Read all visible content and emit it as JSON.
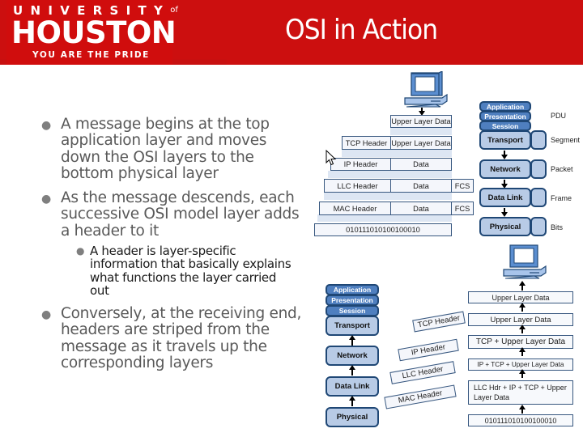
{
  "header": {
    "logo": {
      "line1": "UNIVERSITY",
      "line1_suffix": "of",
      "line2": "HOUSTON",
      "line3": "YOU ARE THE PRIDE"
    },
    "title": "OSI in Action",
    "brand_color": "#cc0f0f"
  },
  "bullets": [
    {
      "level": 1,
      "text": [
        "A message begins at the top",
        "application layer and moves",
        "down the OSI layers to the",
        "bottom physical layer"
      ]
    },
    {
      "level": 1,
      "text": [
        "As the message descends, each",
        "successive OSI model layer adds",
        "a header to it"
      ]
    },
    {
      "level": 2,
      "text": [
        "A header is layer-specific",
        "information that basically explains",
        "what functions the layer carried",
        "out"
      ]
    },
    {
      "level": 1,
      "text": [
        "Conversely, at the receiving end,",
        "headers are striped from the",
        "message as it travels up the",
        "corresponding layers"
      ]
    }
  ],
  "sending_diagram": {
    "encapsulation_rows": [
      {
        "cells": [
          "Upper Layer Data"
        ]
      },
      {
        "cells": [
          "TCP Header",
          "Upper Layer Data"
        ]
      },
      {
        "cells": [
          "IP Header",
          "Data"
        ]
      },
      {
        "cells": [
          "LLC Header",
          "Data",
          "FCS"
        ]
      },
      {
        "cells": [
          "MAC Header",
          "Data",
          "FCS"
        ]
      },
      {
        "cells": [
          "010111010100100010"
        ]
      }
    ],
    "layers": {
      "upper": [
        "Application",
        "Presentation",
        "Session"
      ],
      "main": [
        "Transport",
        "Network",
        "Data Link",
        "Physical"
      ]
    },
    "pdu_header": "PDU",
    "pdu_labels": [
      "Segment",
      "Packet",
      "Frame",
      "Bits"
    ]
  },
  "receiving_diagram": {
    "layers": {
      "upper": [
        "Application",
        "Presentation",
        "Session"
      ],
      "main": [
        "Transport",
        "Network",
        "Data Link",
        "Physical"
      ]
    },
    "stripped_headers": [
      "TCP Header",
      "IP Header",
      "LLC Header",
      "MAC Header"
    ],
    "stack_rows": [
      "Upper Layer Data",
      "Upper Layer Data",
      "TCP + Upper Layer Data",
      "IP + TCP + Upper Layer Data",
      [
        "LLC Hdr + IP + TCP + Upper",
        "Layer Data"
      ],
      "010111010100100010"
    ]
  }
}
